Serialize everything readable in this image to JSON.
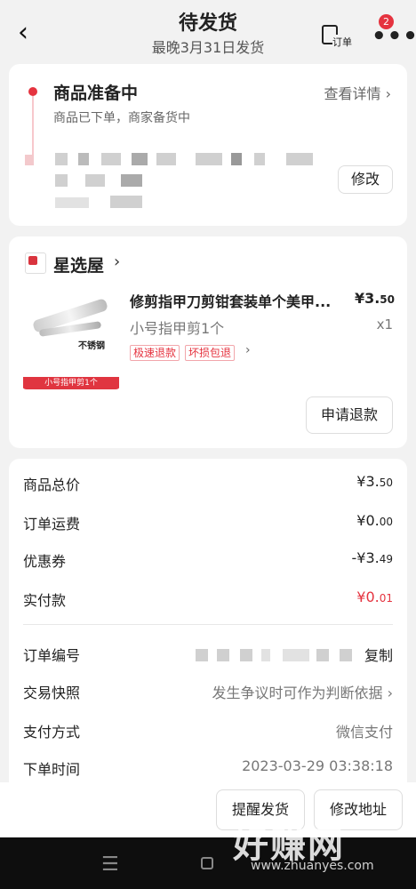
{
  "header": {
    "back_icon": "‹",
    "title": "待发货",
    "subtitle": "最晚3月31日发货",
    "order_icon_label": "订单",
    "more_icon": "•••",
    "badge_count": "2"
  },
  "status": {
    "title": "商品准备中",
    "desc": "商品已下单，商家备货中",
    "detail_link": "查看详情 ›",
    "modify_label": "修改"
  },
  "shop": {
    "name": "星选屋",
    "chevron": "›",
    "product": {
      "image_tag": "不锈钢",
      "image_banner": "小号指甲剪1个",
      "name": "修剪指甲刀剪钳套装单个美甲...",
      "price_main": "¥3.",
      "price_small": "50",
      "spec": "小号指甲剪1个",
      "qty": "x1",
      "tags": [
        "极速退款",
        "坏损包退"
      ]
    },
    "refund_label": "申请退款"
  },
  "summary": {
    "rows": [
      {
        "label": "商品总价",
        "main": "¥3.",
        "small": "50"
      },
      {
        "label": "订单运费",
        "main": "¥0.",
        "small": "00"
      },
      {
        "label": "优惠券",
        "main": "-¥3.",
        "small": "49"
      },
      {
        "label": "实付款",
        "main": "¥0.",
        "small": "01"
      }
    ],
    "info": [
      {
        "label": "订单编号",
        "value": "复制"
      },
      {
        "label": "交易快照",
        "value": "发生争议时可作为判断依据 ›"
      },
      {
        "label": "支付方式",
        "value": "微信支付"
      },
      {
        "label": "下单时间",
        "value": "2023-03-29 03:38:18"
      }
    ]
  },
  "bottom": {
    "remind_label": "提醒发货",
    "change_address_label": "修改地址"
  },
  "nav": {
    "menu_icon": "☰"
  },
  "watermark": {
    "main": "好赚网",
    "url": "www.zhuanyes.com"
  },
  "colors": {
    "accent": "#e5333f",
    "background": "#f2f2f2"
  }
}
